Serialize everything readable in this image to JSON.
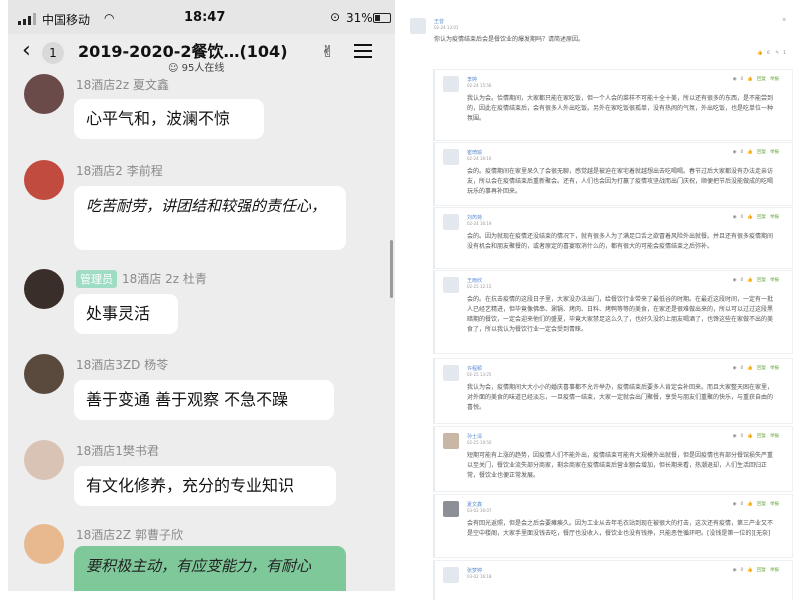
{
  "status_bar": {
    "carrier": "中国移动",
    "time": "18:47",
    "battery": "31%"
  },
  "nav": {
    "back_count": "1",
    "title": "2019-2020-2餐饮…(104)",
    "online": "95人在线"
  },
  "messages": [
    {
      "sender": "18酒店2z 夏文鑫",
      "text": "心平气和，波澜不惊",
      "style": "normal"
    },
    {
      "sender": "18酒店2 李前程",
      "text": "吃苦耐劳，讲团结和较强的责任心，",
      "style": "handwritten"
    },
    {
      "badge": "管理员",
      "sender": "18酒店 2z 杜青",
      "text": "处事灵活",
      "style": "normal"
    },
    {
      "sender": "18酒店3ZD 杨苓",
      "text": "善于变通  善于观察 不急不躁",
      "style": "normal"
    },
    {
      "sender": "18酒店1樊书君",
      "text": "有文化修养，充分的专业知识",
      "style": "normal"
    },
    {
      "sender": "18酒店2Z 郭曹子欣",
      "text": "要积极主动，有应变能力，有耐心",
      "style": "handwritten-green"
    }
  ],
  "forum": {
    "main_post": {
      "name": "王曾",
      "date": "02-24 13:01",
      "body": "你认为疫情结束后会是餐饮业的爆发期吗？请简述原因。",
      "likes": "6",
      "comments": "1"
    },
    "replies": [
      {
        "name": "李婷",
        "date": "02-24 15:56",
        "body": "我认为会。恰情期间，大家都只能在家吃饭，但一个人会的菜样不可能十全十美，所以还有很多的东西，是不能尝到的，因此在疫情结束后，会有很多人外出吃饭。另外在家吃饭很孤单，没有热闹的气氛，外出吃饭，也是吃单位一种氛围。",
        "actions": [
          "0",
          "回复",
          "举报"
        ]
      },
      {
        "name": "崔琦瑜",
        "date": "02-24 16:16",
        "body": "会的。疫情期间在家里呆久了会很无聊，感觉越是被迫在家宅着就越想出去吃喝喝。春节过后大家都没有办法走亲访友，所以会在疫情结束后重新聚会。还有，人们也会因为打赢了疫情攻坚战而出门庆祝，顺便把节后没能做成的吃喝玩乐的事再补回来。",
        "actions": [
          "0",
          "回复",
          "举报"
        ]
      },
      {
        "name": "刘芮荷",
        "date": "02-24 16:19",
        "body": "会的。因为就现在疫情还没结束的情况下，就有很多人为了满足口舌之欲冒着风险外出就餐。并且还有很多疫情期间没有机会和朋友聚餐的，或者原定的喜宴取消什么的，都有很大的可能会疫情结束之后弥补。",
        "actions": [
          "0",
          "回复",
          "举报"
        ]
      },
      {
        "name": "王雨欣",
        "date": "02-25 12:15",
        "body": "会的。在抗击疫情的这段日子里，大家没办法出门，给餐饮行业带来了最低谷的时期。在最近这段时间，一定有一批人已经艺精进，但毕竟像佛串、涮锅、烤肉、日料、烤鸭等等的美食，在家还是很难做出来的，所以可以过过这段黑暗期的餐饮，一定会迎来他们的盛夏，毕竟大家禁足这么久了，也好久没约上朋友喝酒了，也馋这些在家做不出的美食了，所以我认为餐饮行业一定会受到青睐。",
        "actions": [
          "0",
          "回复",
          "举报"
        ]
      },
      {
        "name": "许程颖",
        "date": "02-25 13:25",
        "body": "我认为会，疫情期间大大小小的婚庆喜事都不允许举办，疫情结束后要多人肯定会补回来。而且大家整天困在家里，对外面的美食的味道已经淡忘，一旦疫情一结束，大家一定就会出门聚餐，享受与朋友们重聚的快乐，与重获自由的喜悦。",
        "actions": [
          "0",
          "回复",
          "举报"
        ]
      },
      {
        "name": "孙士清",
        "date": "02-25 19:50",
        "body": "短期可能有上涨的趋势，因疫情人们不能外出，疫情结束可能有大规模外出就餐，但是因疫情也有部分餐馆损失严重以至关门，餐饮业流失部分商家，剩余商家在疫情结束后营业额会增加，但长期来看，热潮退却，人们生活回归正常，餐饮业也便正常发展。",
        "actions": [
          "0",
          "回复",
          "举报"
        ]
      },
      {
        "name": "夏文鑫",
        "date": "03-02 16:07",
        "body": "会有回光返照，但是会之后会要瘫痪久。因为工业从去年毛衣站到现在被很大的打击，这次还有疫情，第三产业又不是空中楼阁，大家手里面没钱去吃，餐厅也没收入，餐饮业也没有钱挣，只能恶性循环吧。[没钱是第一位的][无奈]",
        "actions": [
          "0",
          "回复",
          "举报"
        ]
      },
      {
        "name": "张梦婷",
        "date": "03-02 16:18",
        "body": "",
        "actions": [
          "0",
          "回复",
          "举报"
        ]
      }
    ]
  }
}
